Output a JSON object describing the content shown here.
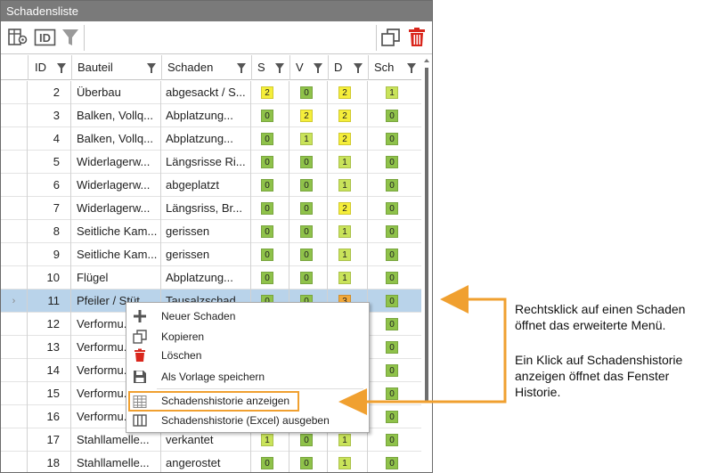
{
  "panel": {
    "title": "Schadensliste"
  },
  "toolbar": {
    "left_icons": [
      "table-settings-icon",
      "id-icon",
      "filter-icon"
    ],
    "right_icons": [
      "copy-icon",
      "trash-icon"
    ],
    "id_label": "ID"
  },
  "columns": {
    "id": "ID",
    "bauteil": "Bauteil",
    "schaden": "Schaden",
    "s": "S",
    "v": "V",
    "d": "D",
    "sch": "Sch"
  },
  "rows": [
    {
      "id": "2",
      "bauteil": "Überbau",
      "schaden": "abgesackt / S...",
      "s": "2",
      "v": "0",
      "d": "2",
      "sch": "1"
    },
    {
      "id": "3",
      "bauteil": "Balken, Vollq...",
      "schaden": "Abplatzung...",
      "s": "0",
      "v": "2",
      "d": "2",
      "sch": "0"
    },
    {
      "id": "4",
      "bauteil": "Balken, Vollq...",
      "schaden": "Abplatzung...",
      "s": "0",
      "v": "1",
      "d": "2",
      "sch": "0"
    },
    {
      "id": "5",
      "bauteil": "Widerlagerw...",
      "schaden": "Längsrisse Ri...",
      "s": "0",
      "v": "0",
      "d": "1",
      "sch": "0"
    },
    {
      "id": "6",
      "bauteil": "Widerlagerw...",
      "schaden": "abgeplatzt",
      "s": "0",
      "v": "0",
      "d": "1",
      "sch": "0"
    },
    {
      "id": "7",
      "bauteil": "Widerlagerw...",
      "schaden": "Längsriss, Br...",
      "s": "0",
      "v": "0",
      "d": "2",
      "sch": "0"
    },
    {
      "id": "8",
      "bauteil": "Seitliche Kam...",
      "schaden": "gerissen",
      "s": "0",
      "v": "0",
      "d": "1",
      "sch": "0"
    },
    {
      "id": "9",
      "bauteil": "Seitliche Kam...",
      "schaden": "gerissen",
      "s": "0",
      "v": "0",
      "d": "1",
      "sch": "0"
    },
    {
      "id": "10",
      "bauteil": "Flügel",
      "schaden": "Abplatzung...",
      "s": "0",
      "v": "0",
      "d": "1",
      "sch": "0"
    },
    {
      "id": "11",
      "bauteil": "Pfeiler / Stüt...",
      "schaden": "Tausalzschad...",
      "s": "0",
      "v": "0",
      "d": "3",
      "sch": "0",
      "indicator": "›"
    },
    {
      "id": "12",
      "bauteil": "Verformu...",
      "schaden": "",
      "s": "",
      "v": "",
      "d": "",
      "sch": "0"
    },
    {
      "id": "13",
      "bauteil": "Verformu...",
      "schaden": "",
      "s": "",
      "v": "",
      "d": "",
      "sch": "0"
    },
    {
      "id": "14",
      "bauteil": "Verformu...",
      "schaden": "",
      "s": "",
      "v": "",
      "d": "",
      "sch": "0"
    },
    {
      "id": "15",
      "bauteil": "Verformu...",
      "schaden": "",
      "s": "",
      "v": "",
      "d": "",
      "sch": "0"
    },
    {
      "id": "16",
      "bauteil": "Verformu...",
      "schaden": "",
      "s": "",
      "v": "",
      "d": "",
      "sch": "0"
    },
    {
      "id": "17",
      "bauteil": "Stahllamelle...",
      "schaden": "verkantet",
      "s": "1",
      "v": "0",
      "d": "1",
      "sch": "0"
    },
    {
      "id": "18",
      "bauteil": "Stahllamelle...",
      "schaden": "angerostet",
      "s": "0",
      "v": "0",
      "d": "1",
      "sch": "0"
    }
  ],
  "selected_row_id": "11",
  "rating_colors": {
    "0": "#8fc24a",
    "1": "#c9e35a",
    "2": "#f5ee3a",
    "3": "#f3a93a"
  },
  "context_menu": {
    "items": [
      {
        "label": "Neuer Schaden",
        "icon": "plus-icon"
      },
      {
        "label": "Kopieren",
        "icon": "copy-icon"
      },
      {
        "label": "Löschen",
        "icon": "trash-icon"
      },
      {
        "label": "Als Vorlage speichern",
        "icon": "save-icon"
      },
      {
        "label": "Schadenshistorie anzeigen",
        "icon": "table-grid-icon",
        "highlighted": true
      },
      {
        "label": "Schadenshistorie (Excel) ausgeben",
        "icon": "columns-icon"
      }
    ]
  },
  "annotation": {
    "text1_line1": "Rechtsklick auf einen Schaden",
    "text1_line2": "öffnet das erweiterte Menü.",
    "text2_line1": "Ein Klick auf Schadenshistorie",
    "text2_line2": "anzeigen öffnet das Fenster",
    "text2_line3": "Historie.",
    "arrow_color": "#f0a030"
  }
}
